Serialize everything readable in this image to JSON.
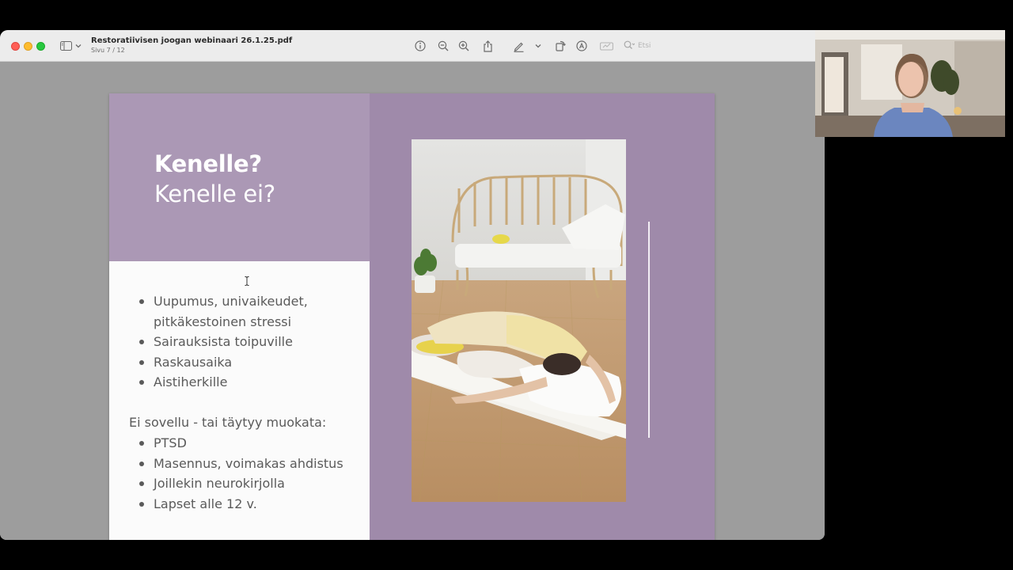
{
  "window": {
    "doc_title": "Restoratiivisen joogan webinaari 26.1.25.pdf",
    "page_indicator": "Sivu 7 / 12",
    "search_placeholder": "Etsi"
  },
  "toolbar_icons": [
    "sidebar-icon",
    "chevron-down-icon",
    "info-icon",
    "zoom-out-icon",
    "zoom-in-icon",
    "share-icon",
    "markup-pen-icon",
    "chevron-down-icon",
    "rotate-icon",
    "annotate-icon",
    "form-icon",
    "search-icon"
  ],
  "slide": {
    "heading_bold": "Kenelle?",
    "heading_regular": "Kenelle ei?",
    "suitable": [
      "Uupumus, univaikeudet,",
      "pitkäkestoinen stressi",
      "Sairauksista toipuville",
      "Raskausaika",
      "Aistiherkille"
    ],
    "not_suitable_heading": "Ei sovellu - tai täytyy muokata:",
    "not_suitable": [
      "PTSD",
      "Masennus, voimakas ahdistus",
      "Joillekin neurokirjolla",
      "Lapset alle 12 v."
    ]
  },
  "colors": {
    "slide_purple": "#9f8aaa",
    "slide_light_purple": "#ab98b5",
    "text_gray": "#5a5a5a"
  }
}
